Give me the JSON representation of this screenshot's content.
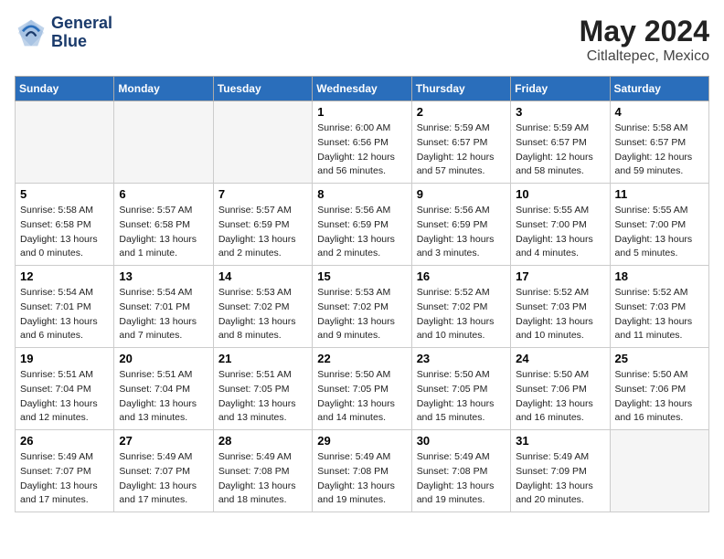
{
  "header": {
    "logo_line1": "General",
    "logo_line2": "Blue",
    "month_year": "May 2024",
    "location": "Citlaltepec, Mexico"
  },
  "weekdays": [
    "Sunday",
    "Monday",
    "Tuesday",
    "Wednesday",
    "Thursday",
    "Friday",
    "Saturday"
  ],
  "weeks": [
    [
      {
        "day": "",
        "info": ""
      },
      {
        "day": "",
        "info": ""
      },
      {
        "day": "",
        "info": ""
      },
      {
        "day": "1",
        "info": "Sunrise: 6:00 AM\nSunset: 6:56 PM\nDaylight: 12 hours\nand 56 minutes."
      },
      {
        "day": "2",
        "info": "Sunrise: 5:59 AM\nSunset: 6:57 PM\nDaylight: 12 hours\nand 57 minutes."
      },
      {
        "day": "3",
        "info": "Sunrise: 5:59 AM\nSunset: 6:57 PM\nDaylight: 12 hours\nand 58 minutes."
      },
      {
        "day": "4",
        "info": "Sunrise: 5:58 AM\nSunset: 6:57 PM\nDaylight: 12 hours\nand 59 minutes."
      }
    ],
    [
      {
        "day": "5",
        "info": "Sunrise: 5:58 AM\nSunset: 6:58 PM\nDaylight: 13 hours\nand 0 minutes."
      },
      {
        "day": "6",
        "info": "Sunrise: 5:57 AM\nSunset: 6:58 PM\nDaylight: 13 hours\nand 1 minute."
      },
      {
        "day": "7",
        "info": "Sunrise: 5:57 AM\nSunset: 6:59 PM\nDaylight: 13 hours\nand 2 minutes."
      },
      {
        "day": "8",
        "info": "Sunrise: 5:56 AM\nSunset: 6:59 PM\nDaylight: 13 hours\nand 2 minutes."
      },
      {
        "day": "9",
        "info": "Sunrise: 5:56 AM\nSunset: 6:59 PM\nDaylight: 13 hours\nand 3 minutes."
      },
      {
        "day": "10",
        "info": "Sunrise: 5:55 AM\nSunset: 7:00 PM\nDaylight: 13 hours\nand 4 minutes."
      },
      {
        "day": "11",
        "info": "Sunrise: 5:55 AM\nSunset: 7:00 PM\nDaylight: 13 hours\nand 5 minutes."
      }
    ],
    [
      {
        "day": "12",
        "info": "Sunrise: 5:54 AM\nSunset: 7:01 PM\nDaylight: 13 hours\nand 6 minutes."
      },
      {
        "day": "13",
        "info": "Sunrise: 5:54 AM\nSunset: 7:01 PM\nDaylight: 13 hours\nand 7 minutes."
      },
      {
        "day": "14",
        "info": "Sunrise: 5:53 AM\nSunset: 7:02 PM\nDaylight: 13 hours\nand 8 minutes."
      },
      {
        "day": "15",
        "info": "Sunrise: 5:53 AM\nSunset: 7:02 PM\nDaylight: 13 hours\nand 9 minutes."
      },
      {
        "day": "16",
        "info": "Sunrise: 5:52 AM\nSunset: 7:02 PM\nDaylight: 13 hours\nand 10 minutes."
      },
      {
        "day": "17",
        "info": "Sunrise: 5:52 AM\nSunset: 7:03 PM\nDaylight: 13 hours\nand 10 minutes."
      },
      {
        "day": "18",
        "info": "Sunrise: 5:52 AM\nSunset: 7:03 PM\nDaylight: 13 hours\nand 11 minutes."
      }
    ],
    [
      {
        "day": "19",
        "info": "Sunrise: 5:51 AM\nSunset: 7:04 PM\nDaylight: 13 hours\nand 12 minutes."
      },
      {
        "day": "20",
        "info": "Sunrise: 5:51 AM\nSunset: 7:04 PM\nDaylight: 13 hours\nand 13 minutes."
      },
      {
        "day": "21",
        "info": "Sunrise: 5:51 AM\nSunset: 7:05 PM\nDaylight: 13 hours\nand 13 minutes."
      },
      {
        "day": "22",
        "info": "Sunrise: 5:50 AM\nSunset: 7:05 PM\nDaylight: 13 hours\nand 14 minutes."
      },
      {
        "day": "23",
        "info": "Sunrise: 5:50 AM\nSunset: 7:05 PM\nDaylight: 13 hours\nand 15 minutes."
      },
      {
        "day": "24",
        "info": "Sunrise: 5:50 AM\nSunset: 7:06 PM\nDaylight: 13 hours\nand 16 minutes."
      },
      {
        "day": "25",
        "info": "Sunrise: 5:50 AM\nSunset: 7:06 PM\nDaylight: 13 hours\nand 16 minutes."
      }
    ],
    [
      {
        "day": "26",
        "info": "Sunrise: 5:49 AM\nSunset: 7:07 PM\nDaylight: 13 hours\nand 17 minutes."
      },
      {
        "day": "27",
        "info": "Sunrise: 5:49 AM\nSunset: 7:07 PM\nDaylight: 13 hours\nand 17 minutes."
      },
      {
        "day": "28",
        "info": "Sunrise: 5:49 AM\nSunset: 7:08 PM\nDaylight: 13 hours\nand 18 minutes."
      },
      {
        "day": "29",
        "info": "Sunrise: 5:49 AM\nSunset: 7:08 PM\nDaylight: 13 hours\nand 19 minutes."
      },
      {
        "day": "30",
        "info": "Sunrise: 5:49 AM\nSunset: 7:08 PM\nDaylight: 13 hours\nand 19 minutes."
      },
      {
        "day": "31",
        "info": "Sunrise: 5:49 AM\nSunset: 7:09 PM\nDaylight: 13 hours\nand 20 minutes."
      },
      {
        "day": "",
        "info": ""
      }
    ]
  ]
}
